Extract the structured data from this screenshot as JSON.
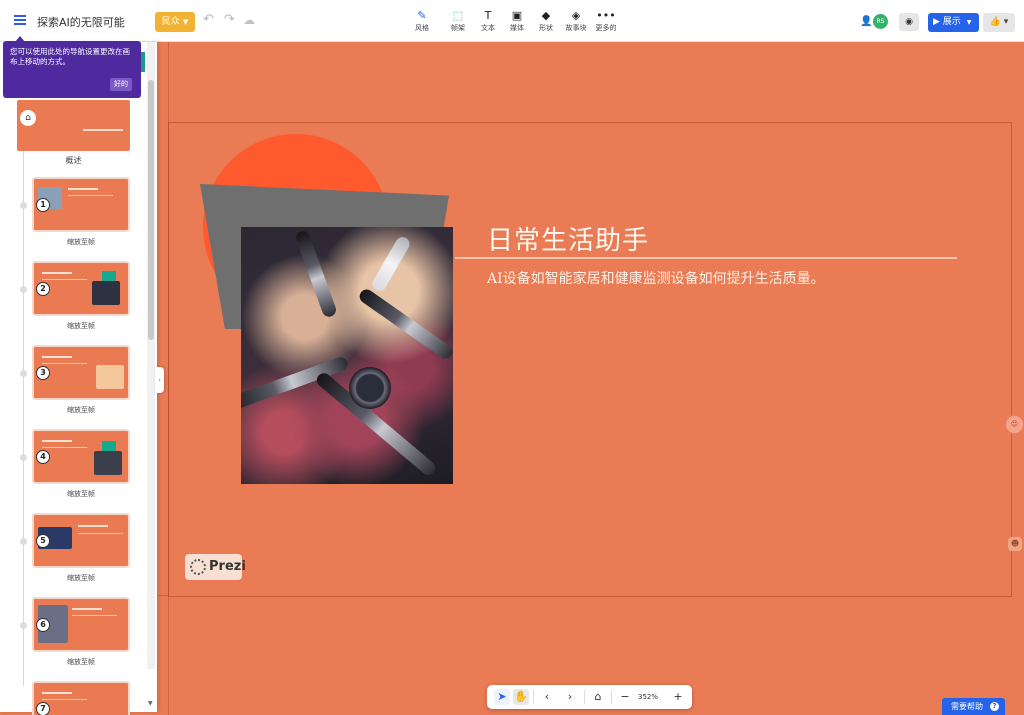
{
  "header": {
    "title": "探索AI的无限可能",
    "audience_label": "民众",
    "tools": [
      {
        "icon": "brush-icon",
        "label": "风格"
      },
      {
        "icon": "frame-icon",
        "label": "帧架"
      },
      {
        "icon": "text-icon",
        "label": "文本"
      },
      {
        "icon": "media-icon",
        "label": "媒体"
      },
      {
        "icon": "shapes-icon",
        "label": "形状"
      },
      {
        "icon": "story-blocks-icon",
        "label": "故事块"
      },
      {
        "icon": "more-icon",
        "label": "更多的"
      }
    ],
    "collaborator_badge": "RS",
    "present_label": "展示"
  },
  "tooltip": {
    "text": "您可以使用此处的导航设置更改在画布上移动的方式。",
    "ok_label": "好的"
  },
  "sidebar": {
    "overview_label": "概述",
    "items": [
      {
        "number": "1",
        "label": "缩放至帧"
      },
      {
        "number": "2",
        "label": "缩放至帧"
      },
      {
        "number": "3",
        "label": "缩放至帧"
      },
      {
        "number": "4",
        "label": "缩放至帧"
      },
      {
        "number": "5",
        "label": "缩放至帧"
      },
      {
        "number": "6",
        "label": "缩放至帧"
      },
      {
        "number": "7",
        "label": ""
      }
    ]
  },
  "slide": {
    "title": "日常生活助手",
    "subtitle": "AI设备如智能家居和健康监测设备如何提升生活质量。",
    "watermark": "Prezi",
    "background_color": "#e97b55",
    "accent_circle_color": "#ff5a2e"
  },
  "navigation": {
    "zoom_level": "352%"
  },
  "help": {
    "label": "需要帮助"
  },
  "colors": {
    "primary_blue": "#2463ea",
    "tooltip_purple": "#4e2a9e",
    "audience_yellow": "#f2b233"
  }
}
